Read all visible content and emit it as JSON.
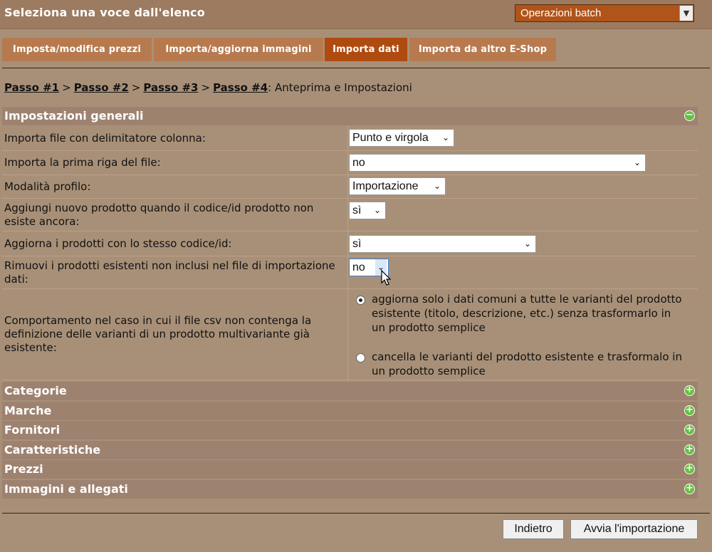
{
  "header": {
    "title": "Seleziona una voce dall'elenco",
    "batch_select": "Operazioni batch"
  },
  "tabs": [
    {
      "label": "Imposta/modifica prezzi",
      "active": false
    },
    {
      "label": "Importa/aggiorna immagini",
      "active": false
    },
    {
      "label": "Importa dati",
      "active": true
    },
    {
      "label": "Importa da altro E-Shop",
      "active": false
    }
  ],
  "breadcrumb": {
    "step1": "Passo #1",
    "step2": "Passo #2",
    "step3": "Passo #3",
    "step4": "Passo #4",
    "sep": ">",
    "current": ": Anteprima e Impostazioni"
  },
  "general": {
    "title": "Impostazioni generali",
    "rows": [
      {
        "label": "Importa file con delimitatore colonna:",
        "value": "Punto e virgola"
      },
      {
        "label": "Importa la prima riga del file:",
        "value": "no"
      },
      {
        "label": "Modalità profilo:",
        "value": "Importazione"
      },
      {
        "label": "Aggiungi nuovo prodotto quando il codice/id prodotto non esiste ancora:",
        "value": "sì"
      },
      {
        "label": "Aggiorna i prodotti con lo stesso codice/id:",
        "value": "sì"
      },
      {
        "label": "Rimuovi i prodotti esistenti non inclusi nel file di importazione dati:",
        "value": "no"
      }
    ],
    "variants": {
      "label": "Comportamento nel caso in cui il file csv non contenga la definizione delle varianti di un prodotto multivariante già esistente:",
      "option1": "aggiorna solo i dati comuni a tutte le varianti del prodotto esistente (titolo, descrizione, etc.) senza trasformarlo in un prodotto semplice",
      "option2": "cancella le varianti del prodotto esistente e trasformalo in un prodotto semplice",
      "selected": 1
    }
  },
  "sections": [
    "Categorie",
    "Marche",
    "Fornitori",
    "Caratteristiche",
    "Prezzi",
    "Immagini e allegati"
  ],
  "buttons": {
    "back": "Indietro",
    "start": "Avvia l'importazione"
  }
}
